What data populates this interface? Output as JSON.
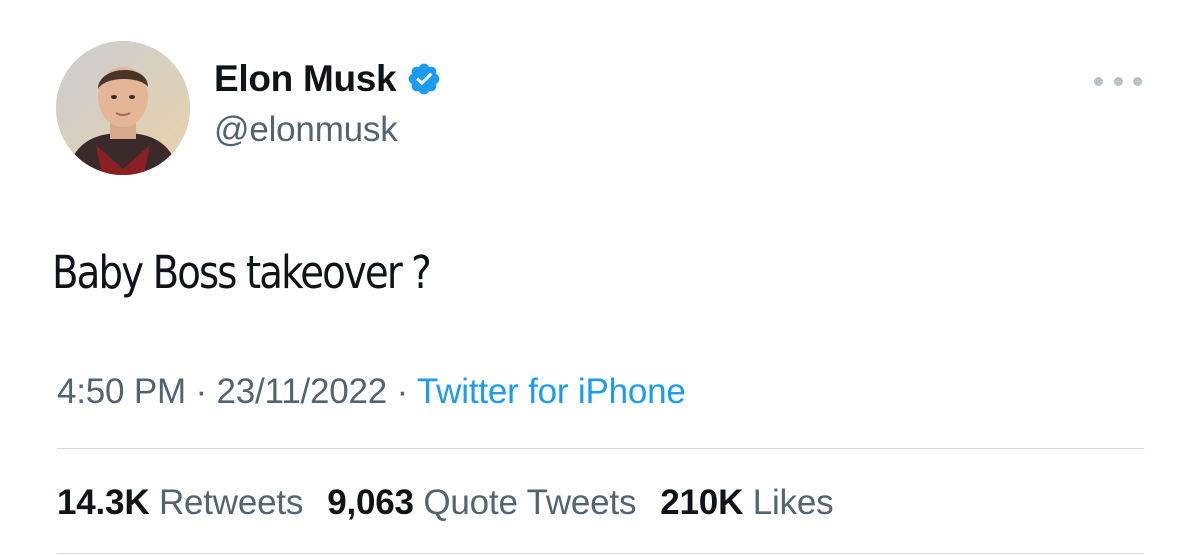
{
  "author": {
    "display_name": "Elon Musk",
    "handle": "@elonmusk",
    "verified": true,
    "avatar_icon": "profile-photo"
  },
  "tweet": {
    "text": "Baby Boss takeover ?"
  },
  "meta": {
    "time": "4:50 PM",
    "separator": " · ",
    "date": "23/11/2022",
    "source": "Twitter for iPhone"
  },
  "stats": {
    "retweets_count": "14.3K",
    "retweets_label": "Retweets",
    "quotes_count": "9,063",
    "quotes_label": "Quote Tweets",
    "likes_count": "210K",
    "likes_label": "Likes"
  },
  "colors": {
    "accent": "#1d9bf0",
    "text_primary": "#0f1419",
    "text_secondary": "#536471",
    "divider": "#d4d9dd"
  }
}
